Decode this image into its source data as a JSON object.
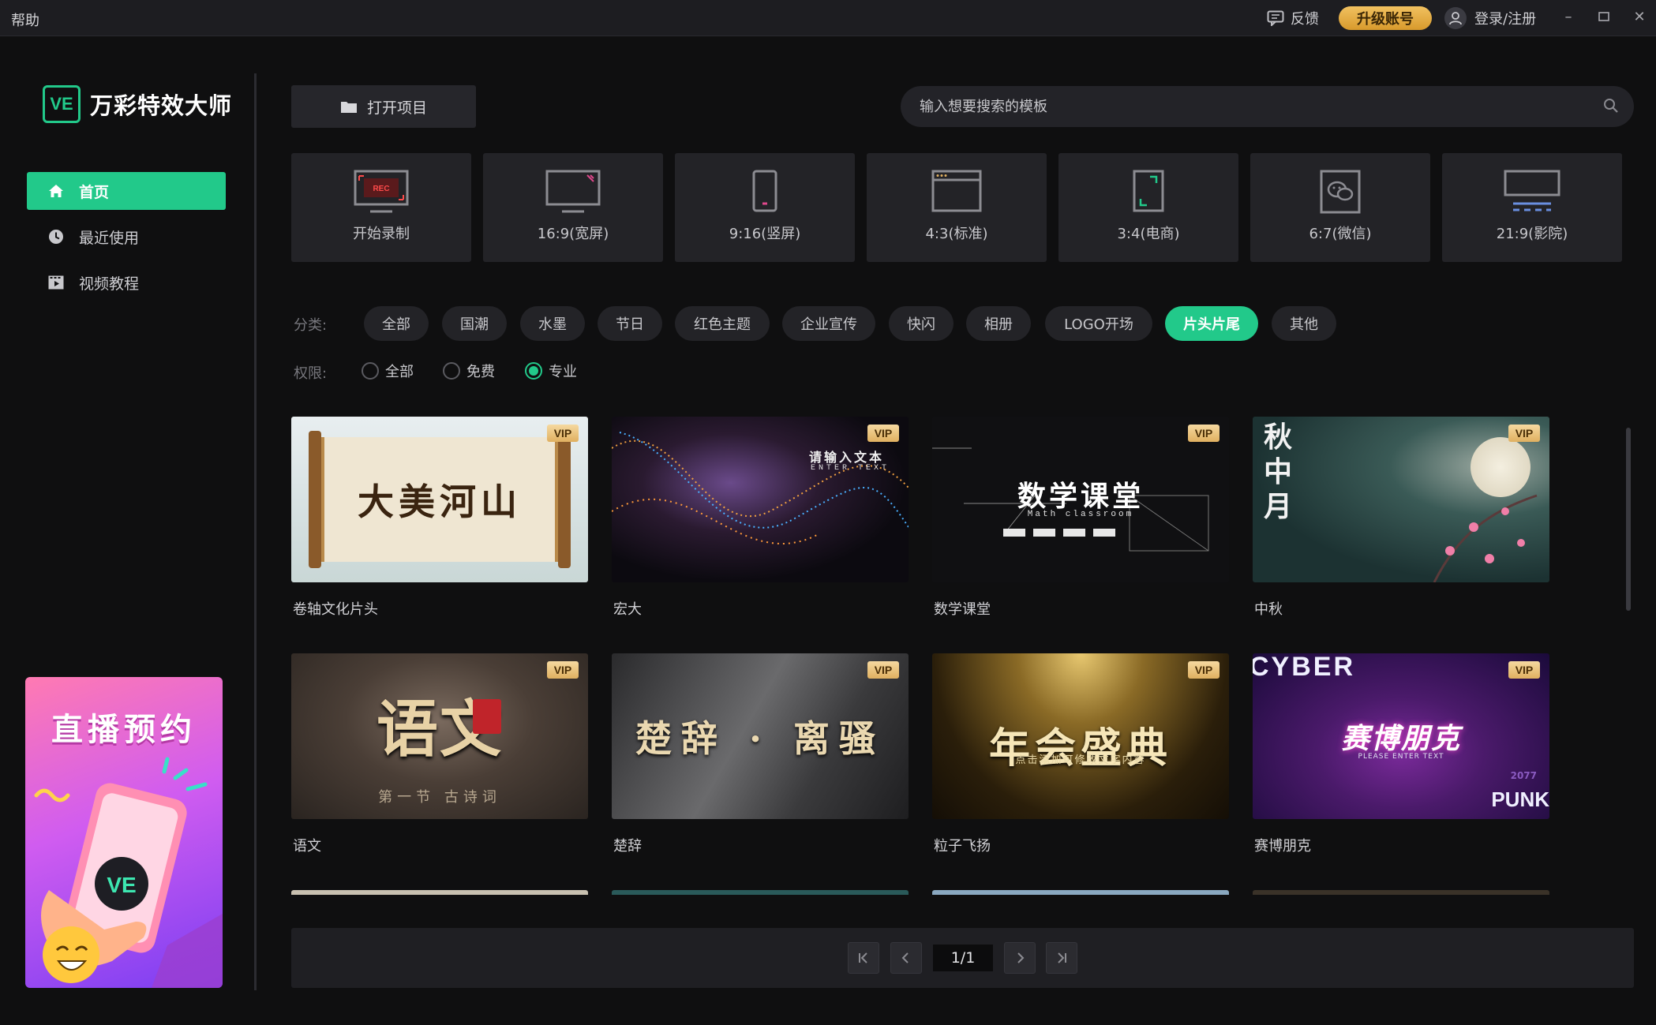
{
  "titlebar": {
    "help": "帮助",
    "feedback": "反馈",
    "upgrade": "升级账号",
    "login": "登录/注册"
  },
  "app": {
    "logo_abbr": "VE",
    "name": "万彩特效大师"
  },
  "sidebar": {
    "items": [
      {
        "label": "首页",
        "icon": "home-icon",
        "active": true
      },
      {
        "label": "最近使用",
        "icon": "clock-icon",
        "active": false
      },
      {
        "label": "视频教程",
        "icon": "video-icon",
        "active": false
      }
    ],
    "promo": {
      "title": "直播预约",
      "badge": "VE"
    }
  },
  "toolbar": {
    "open_project": "打开项目",
    "search_placeholder": "输入想要搜索的模板"
  },
  "ratios": [
    {
      "label": "开始录制",
      "icon": "record-screen-icon",
      "rec": "REC"
    },
    {
      "label": "16:9(宽屏)",
      "icon": "widescreen-icon"
    },
    {
      "label": "9:16(竖屏)",
      "icon": "phone-portrait-icon"
    },
    {
      "label": "4:3(标准)",
      "icon": "standard-window-icon"
    },
    {
      "label": "3:4(电商)",
      "icon": "ecommerce-frame-icon"
    },
    {
      "label": "6:7(微信)",
      "icon": "wechat-icon"
    },
    {
      "label": "21:9(影院)",
      "icon": "cinema-icon"
    }
  ],
  "filters": {
    "category_label": "分类:",
    "categories": [
      "全部",
      "国潮",
      "水墨",
      "节日",
      "红色主题",
      "企业宣传",
      "快闪",
      "相册",
      "LOGO开场",
      "片头片尾",
      "其他"
    ],
    "active_category": "片头片尾",
    "permission_label": "权限:",
    "permissions": [
      "全部",
      "免费",
      "专业"
    ],
    "active_permission": "专业"
  },
  "templates": [
    {
      "name": "卷轴文化片头",
      "thumb_text": "大美河山",
      "vip": "VIP"
    },
    {
      "name": "宏大",
      "thumb_text": "请输入文本",
      "thumb_sub": "ENTER TEXT",
      "vip": "VIP"
    },
    {
      "name": "数学课堂",
      "thumb_text": "数学课堂",
      "thumb_sub": "Math classroom",
      "vip": "VIP"
    },
    {
      "name": "中秋",
      "thumb_text": "秋中月",
      "vip": "VIP"
    },
    {
      "name": "语文",
      "thumb_text": "语文",
      "thumb_sub": "第一节 古诗词",
      "vip": "VIP"
    },
    {
      "name": "楚辞",
      "thumb_text": "楚辞 · 离骚",
      "vip": "VIP"
    },
    {
      "name": "粒子飞扬",
      "thumb_text": "年会盛典",
      "thumb_sub": "点击添加可修改文字内容",
      "vip": "VIP"
    },
    {
      "name": "赛博朋克",
      "thumb_text": "赛博朋克",
      "thumb_sub": "PLEASE ENTER TEXT",
      "thumb_top": "CYBER",
      "thumb_corner": "PUNK",
      "thumb_year": "2077",
      "vip": "VIP"
    }
  ],
  "pagination": {
    "indicator": "1/1"
  },
  "colors": {
    "accent": "#22c98a",
    "vip": "#e0b060",
    "background": "#0f0f10"
  }
}
